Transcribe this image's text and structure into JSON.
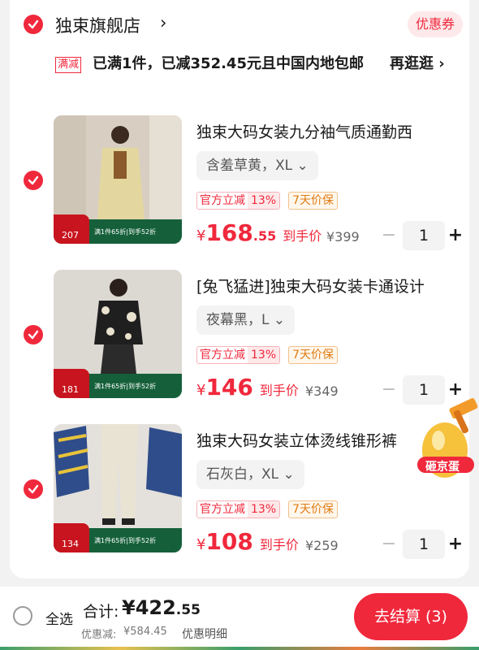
{
  "shop": {
    "name": "独束旗舰店",
    "arrow": "›",
    "coupon_label": "优惠券",
    "promo_tag": "满减",
    "promo_text": "已满1件，已减352.45元且中国内地包邮",
    "promo_link": "再逛逛 ›"
  },
  "items": [
    {
      "title": "独束大码女装九分袖气质通勤西",
      "variant": "含羞草黄，XL ⌄",
      "badge_official": "官方立减",
      "badge_percent": "13%",
      "badge_guarantee": "7天价保",
      "currency": "¥",
      "price_int": "168",
      "price_dec": ".55",
      "price_label": "到手价",
      "orig_price": "¥399",
      "quantity": "1",
      "thumb_num": "207",
      "thumb_banner": "满1件65折|到手52折"
    },
    {
      "title": "[兔飞猛进]独束大码女装卡通设计",
      "variant": "夜幕黑，L ⌄",
      "badge_official": "官方立减",
      "badge_percent": "13%",
      "badge_guarantee": "7天价保",
      "currency": "¥",
      "price_int": "146",
      "price_dec": "",
      "price_label": "到手价",
      "orig_price": "¥349",
      "quantity": "1",
      "thumb_num": "181",
      "thumb_banner": "满1件65折|到手52折"
    },
    {
      "title": "独束大码女装立体烫线锥形裤",
      "variant": "石灰白，XL ⌄",
      "badge_official": "官方立减",
      "badge_percent": "13%",
      "badge_guarantee": "7天价保",
      "currency": "¥",
      "price_int": "108",
      "price_dec": "",
      "price_label": "到手价",
      "orig_price": "¥259",
      "quantity": "1",
      "thumb_num": "134",
      "thumb_banner": "满1件65折|到手52折"
    }
  ],
  "egg": {
    "label": "砸京蛋"
  },
  "footer": {
    "select_all": "全选",
    "total_label": "合计:",
    "total_int": "¥422",
    "total_dec": ".55",
    "discount_label": "优惠减:",
    "discount_value": "¥584.45",
    "discount_detail": "优惠明细",
    "checkout_label": "去结算 (3)"
  },
  "colors": {
    "accent": "#f0283c",
    "guarantee": "#e07b12"
  },
  "icons": {
    "check": "check-icon",
    "plus": "plus-icon",
    "minus": "minus-icon",
    "chevron": "chevron-right-icon"
  }
}
